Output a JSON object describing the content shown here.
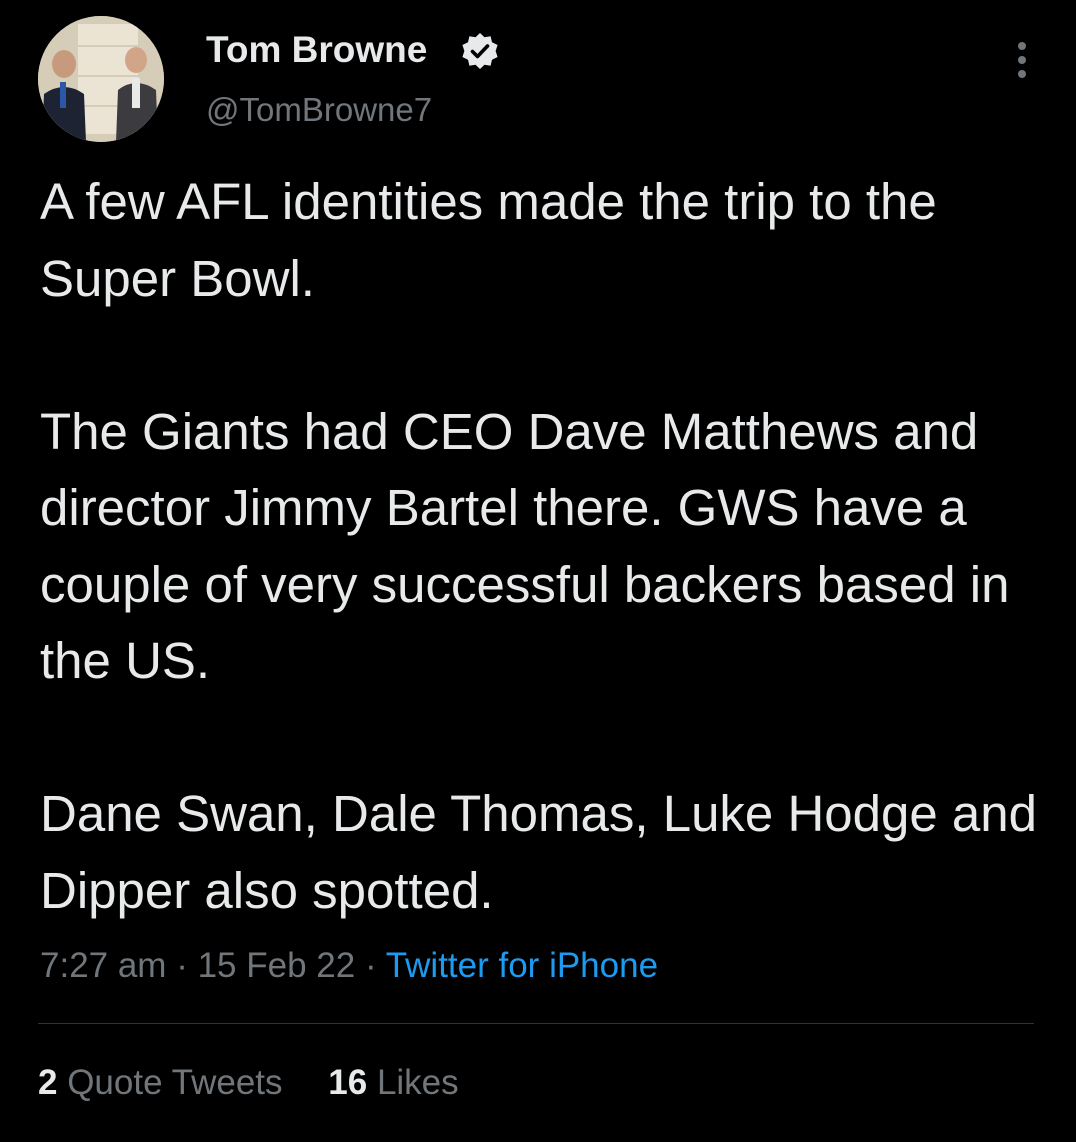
{
  "author": {
    "display_name": "Tom Browne",
    "handle": "@TomBrowne7",
    "verified_icon": "verified-badge-icon",
    "avatar_icon": "avatar-photo"
  },
  "tweet": {
    "text": "A few AFL identities made the trip to the Super Bowl.\n\nThe Giants had CEO Dave Matthews and director Jimmy Bartel there. GWS have a couple of very successful backers based in the US.\n\nDane Swan, Dale Thomas, Luke Hodge and Dipper also spotted.",
    "time": "7:27 am",
    "separator": "·",
    "date": "15 Feb 22",
    "source": "Twitter for iPhone"
  },
  "stats": {
    "quote_tweets_count": "2",
    "quote_tweets_label": "Quote Tweets",
    "likes_count": "16",
    "likes_label": "Likes"
  },
  "colors": {
    "background": "#000000",
    "text": "#e7e9ea",
    "secondary": "#71767b",
    "link": "#1d9bf0"
  },
  "icons": {
    "more": "more-options-icon"
  }
}
